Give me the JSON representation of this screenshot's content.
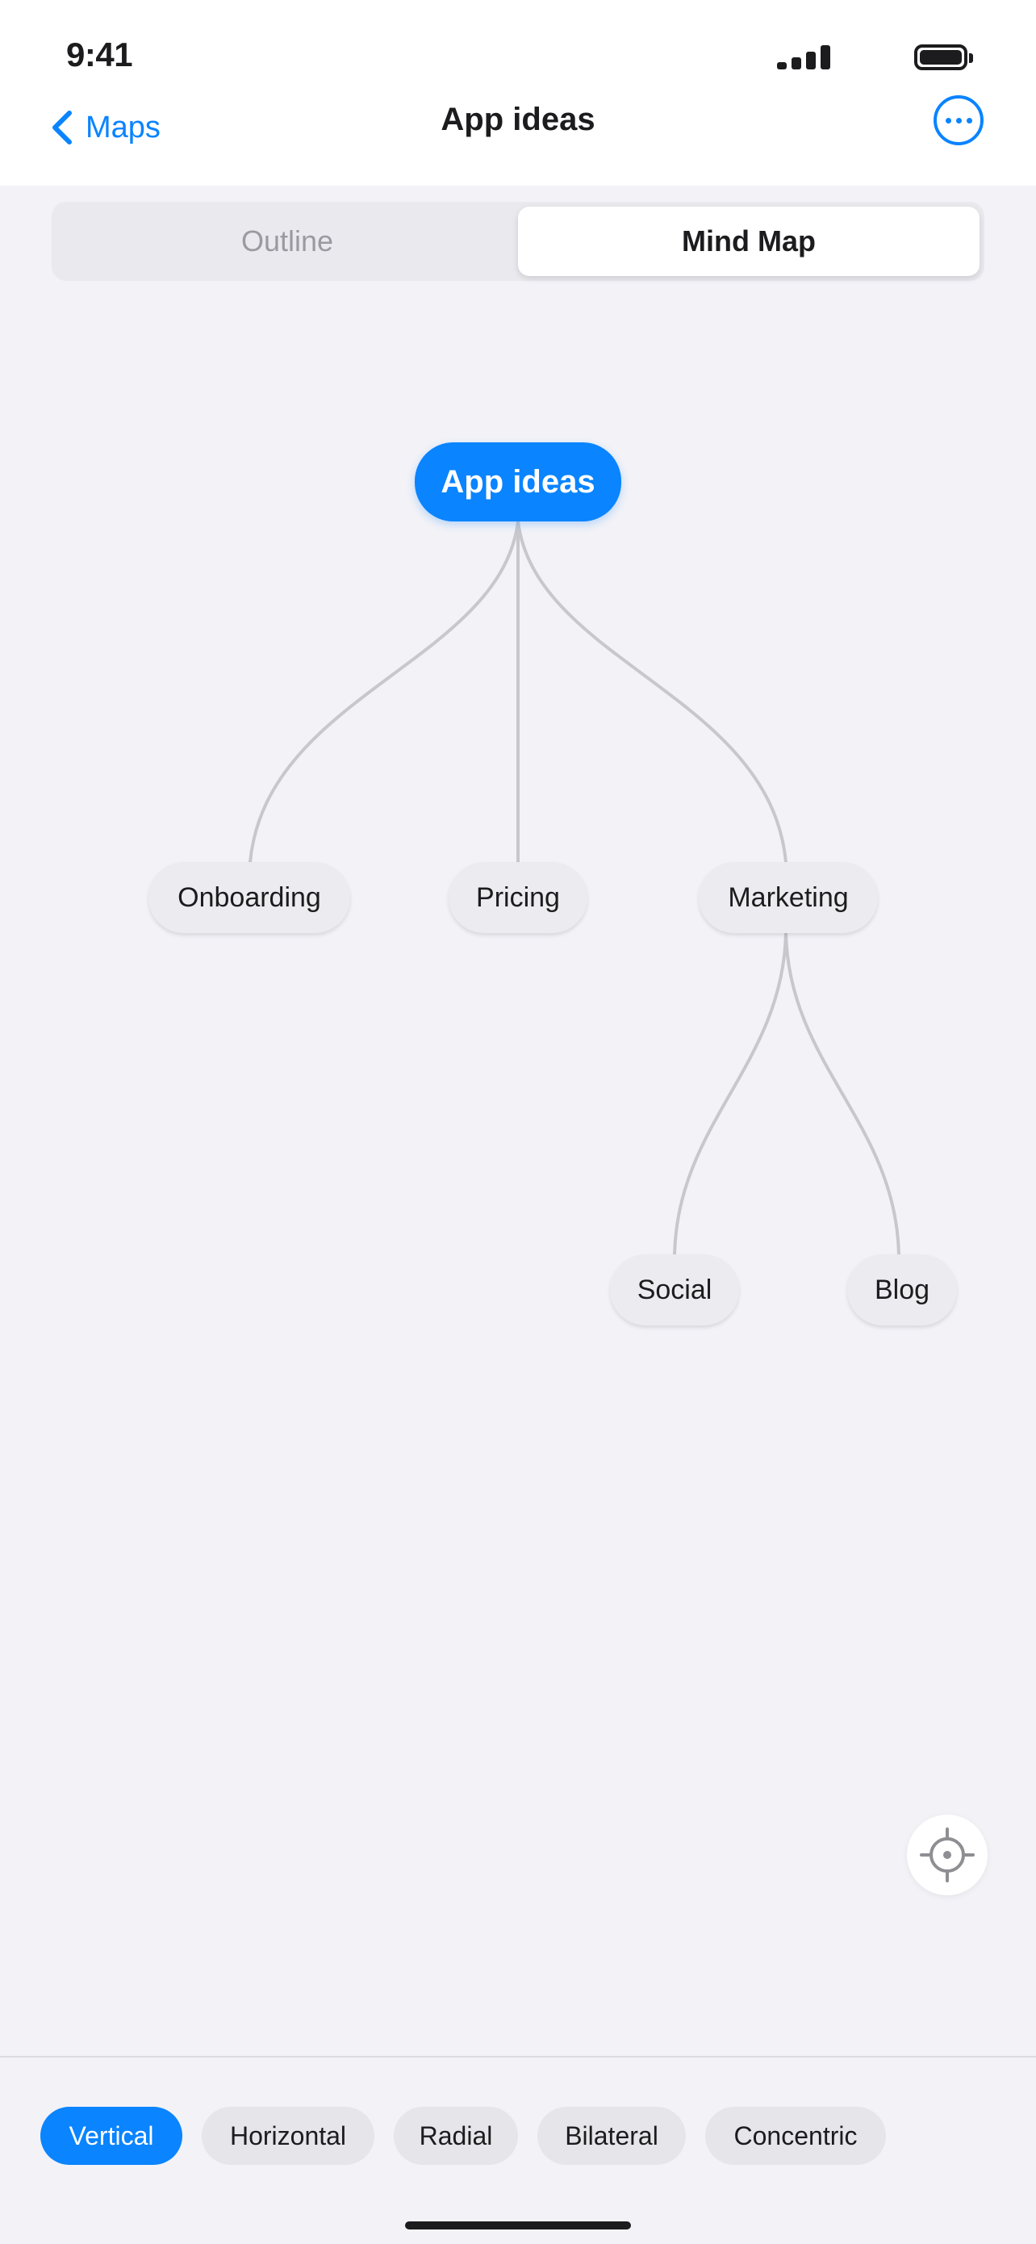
{
  "status_bar": {
    "time": "9:41"
  },
  "nav": {
    "back_label": "Maps",
    "title": "App ideas",
    "more_icon": "ellipsis-circle-icon"
  },
  "segmented": {
    "options": [
      "Outline",
      "Mind Map"
    ],
    "selected": "Mind Map"
  },
  "mind_map": {
    "root": "App ideas",
    "nodes": {
      "onboarding": "Onboarding",
      "pricing": "Pricing",
      "marketing": "Marketing",
      "social": "Social",
      "blog": "Blog"
    },
    "tree": {
      "App ideas": [
        "Onboarding",
        "Pricing",
        "Marketing"
      ],
      "Marketing": [
        "Social",
        "Blog"
      ]
    }
  },
  "recenter_icon": "locate-crosshair-icon",
  "layout_options": {
    "items": [
      "Vertical",
      "Horizontal",
      "Radial",
      "Bilateral",
      "Concentric"
    ],
    "selected": "Vertical"
  },
  "colors": {
    "accent": "#0a84ff",
    "background": "#f2f2f7",
    "connector": "#c7c7cc",
    "node_fill": "#ececf0"
  }
}
